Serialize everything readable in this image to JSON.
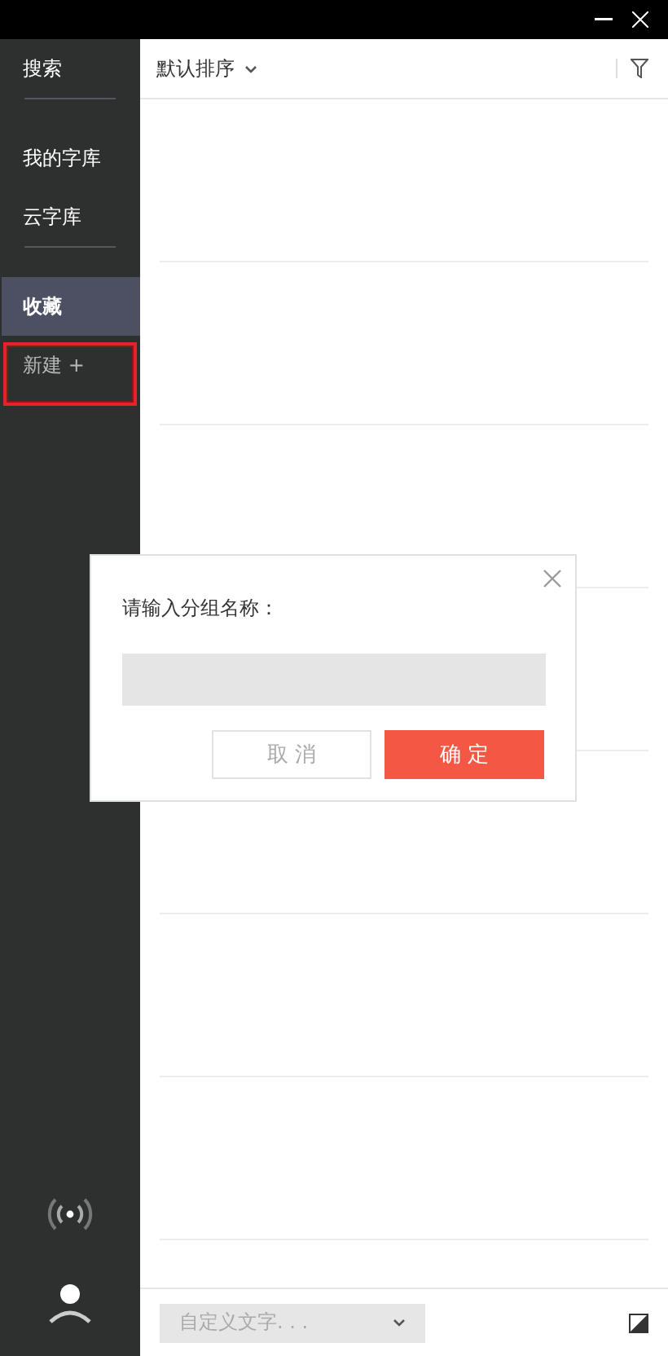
{
  "sidebar": {
    "items": [
      {
        "kind": "item",
        "label": "搜索",
        "selected": false
      },
      {
        "kind": "divider"
      },
      {
        "kind": "item",
        "label": "我的字库",
        "selected": false
      },
      {
        "kind": "item",
        "label": "云字库",
        "selected": false
      },
      {
        "kind": "divider"
      },
      {
        "kind": "item",
        "label": "收藏",
        "selected": true
      },
      {
        "kind": "new",
        "label": "新建 +",
        "selected": false,
        "outlined": true
      }
    ]
  },
  "toolbar": {
    "sort": "默认排序"
  },
  "dialog": {
    "prompt": "请输入分组名称：",
    "cancel": "取 消",
    "confirm": "确 定"
  },
  "footer": {
    "placeholder": "自定义文字. . ."
  }
}
